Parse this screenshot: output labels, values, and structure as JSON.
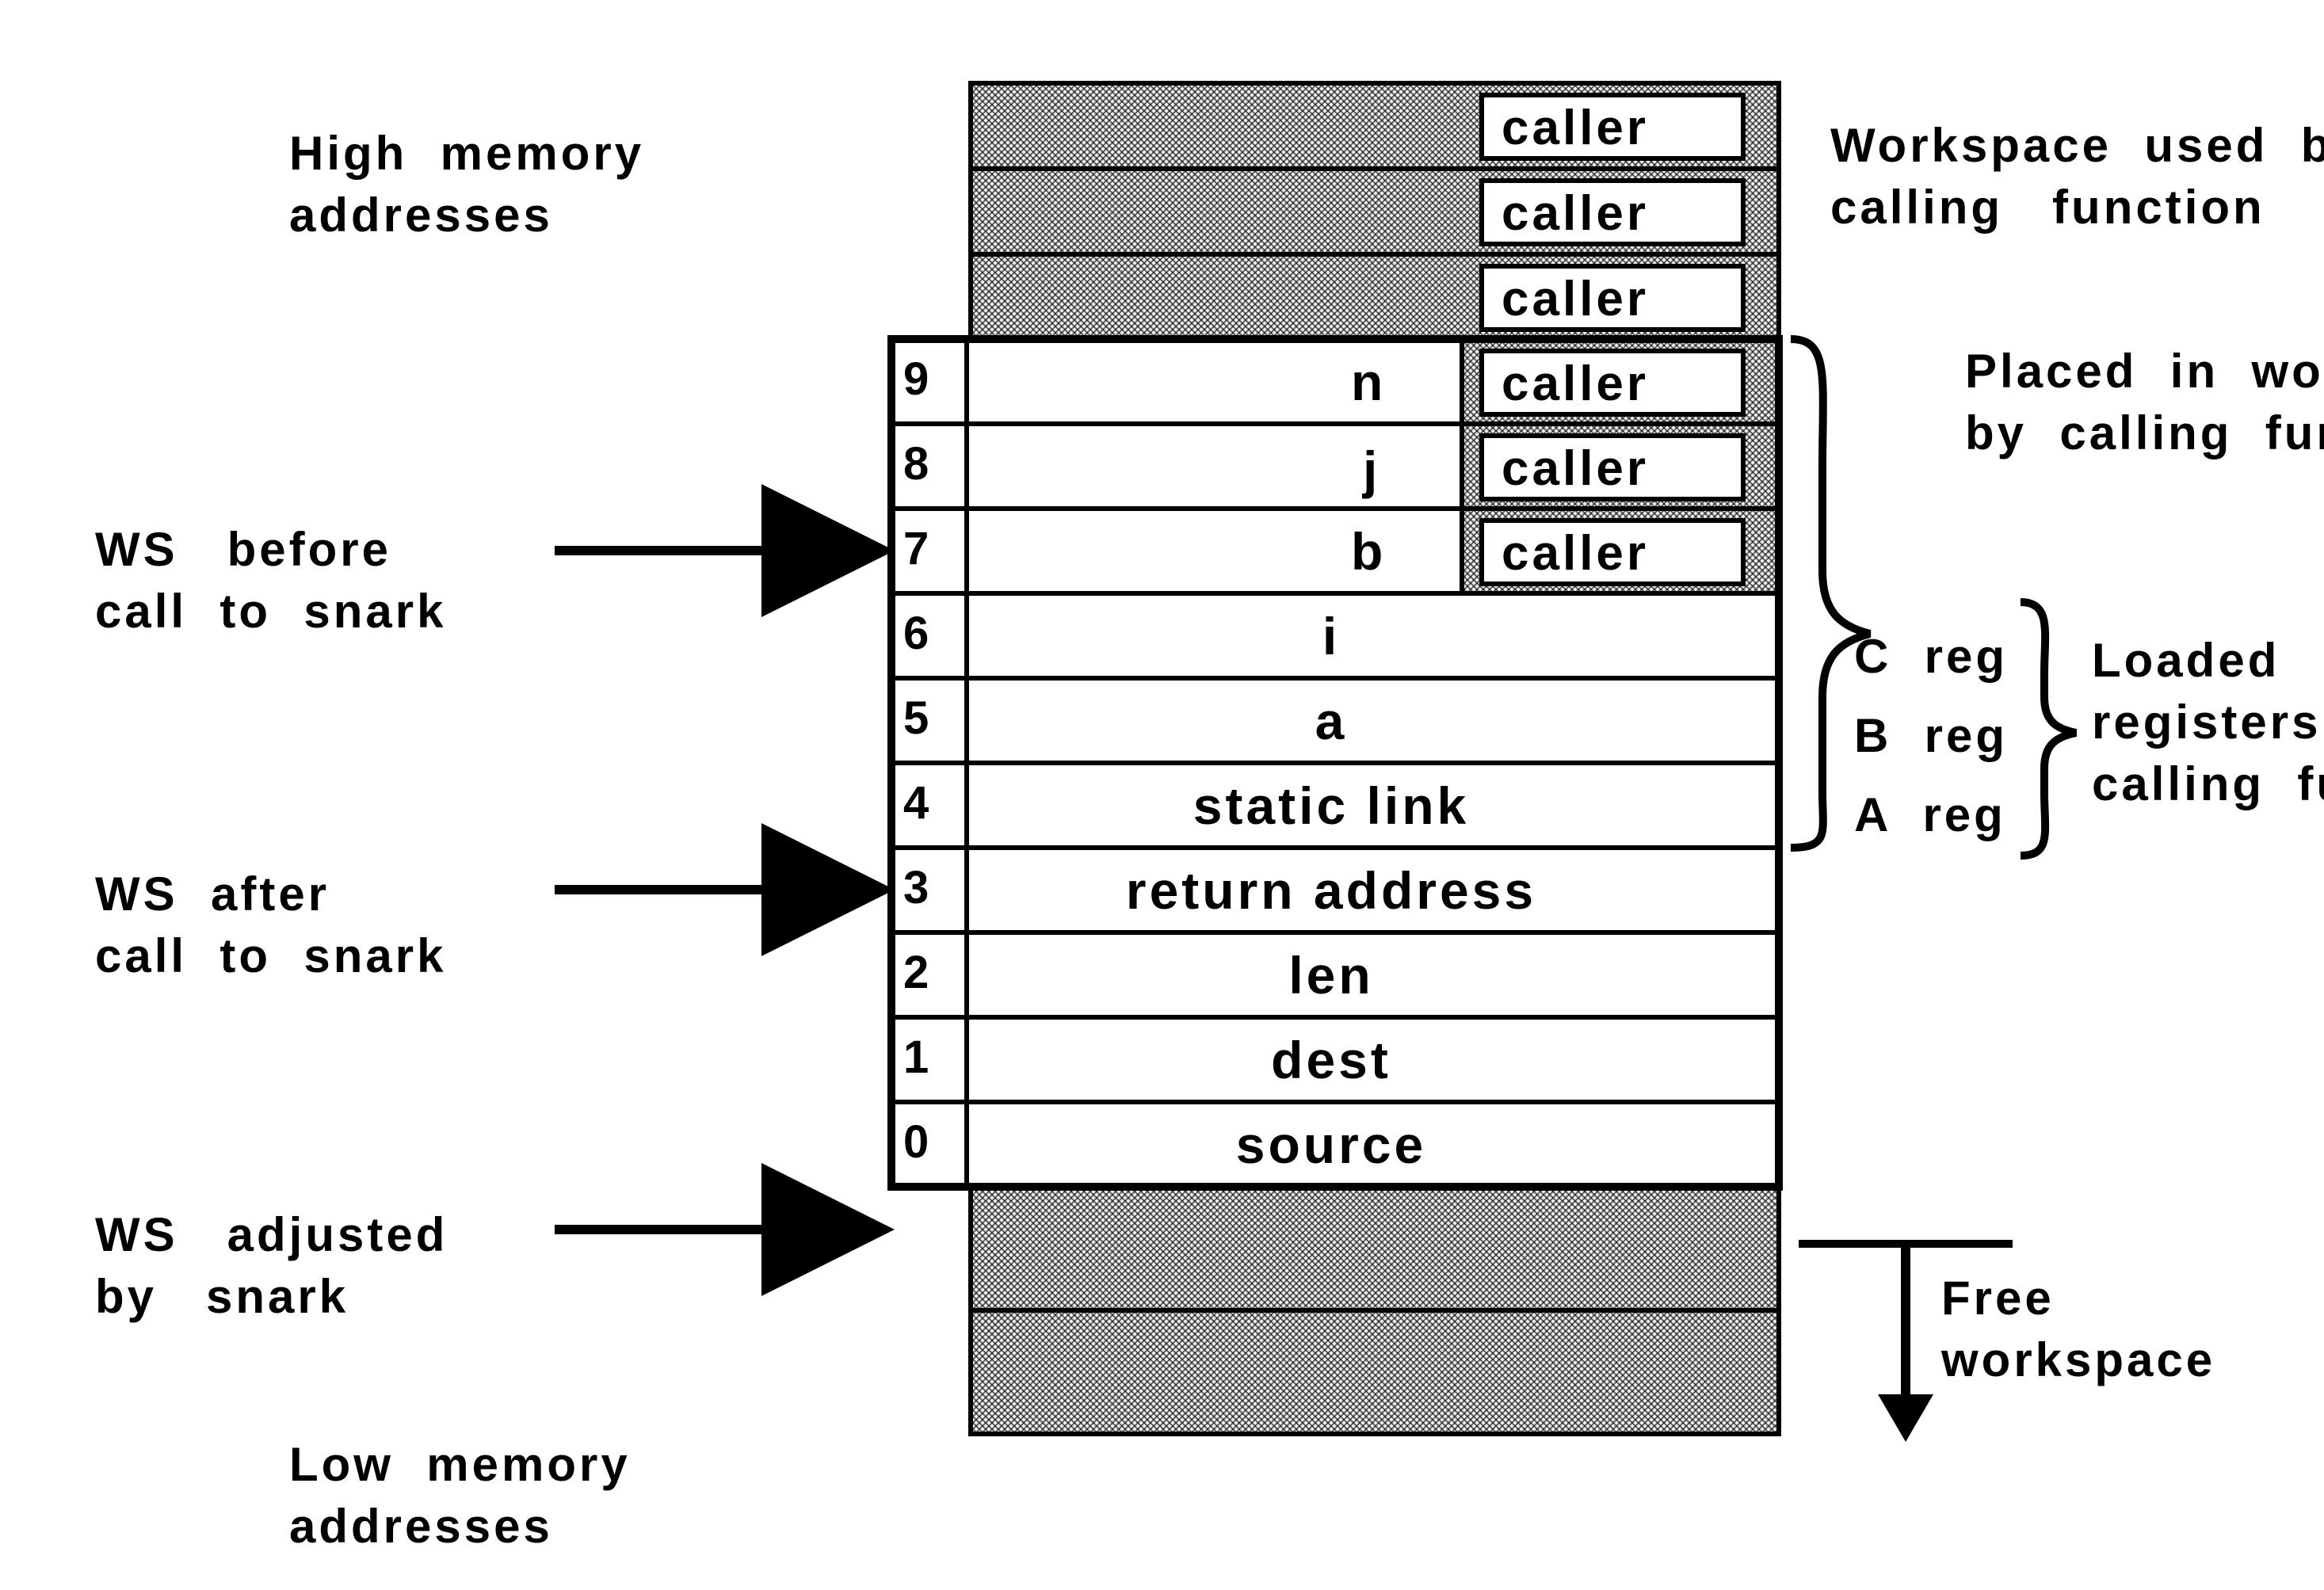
{
  "labels": {
    "highMem": "High  memory\naddresses",
    "lowMem": "Low  memory\naddresses",
    "wsBefore": "WS   before\ncall  to  snark",
    "wsAfter": "WS  after\ncall  to  snark",
    "wsAdjusted": "WS   adjusted\nby   snark",
    "workspaceUsed": "Workspace  used  by\ncalling   function",
    "placed": "Placed  in  workspace\nby  calling  function",
    "regC": "C  reg",
    "regB": "B  reg",
    "regA": "A  reg",
    "loaded": "Loaded   into\nregisters  by\ncalling  function",
    "free": "Free\nworkspace"
  },
  "stack": {
    "callerTop": [
      "caller",
      "caller",
      "caller"
    ],
    "rows": [
      {
        "idx": "9",
        "val": "n",
        "caller": "caller"
      },
      {
        "idx": "8",
        "val": "j",
        "caller": "caller"
      },
      {
        "idx": "7",
        "val": "b",
        "caller": "caller"
      },
      {
        "idx": "6",
        "val": "i"
      },
      {
        "idx": "5",
        "val": "a"
      },
      {
        "idx": "4",
        "val": "static link"
      },
      {
        "idx": "3",
        "val": "return address"
      },
      {
        "idx": "2",
        "val": "len"
      },
      {
        "idx": "1",
        "val": "dest"
      },
      {
        "idx": "0",
        "val": "source"
      }
    ]
  }
}
